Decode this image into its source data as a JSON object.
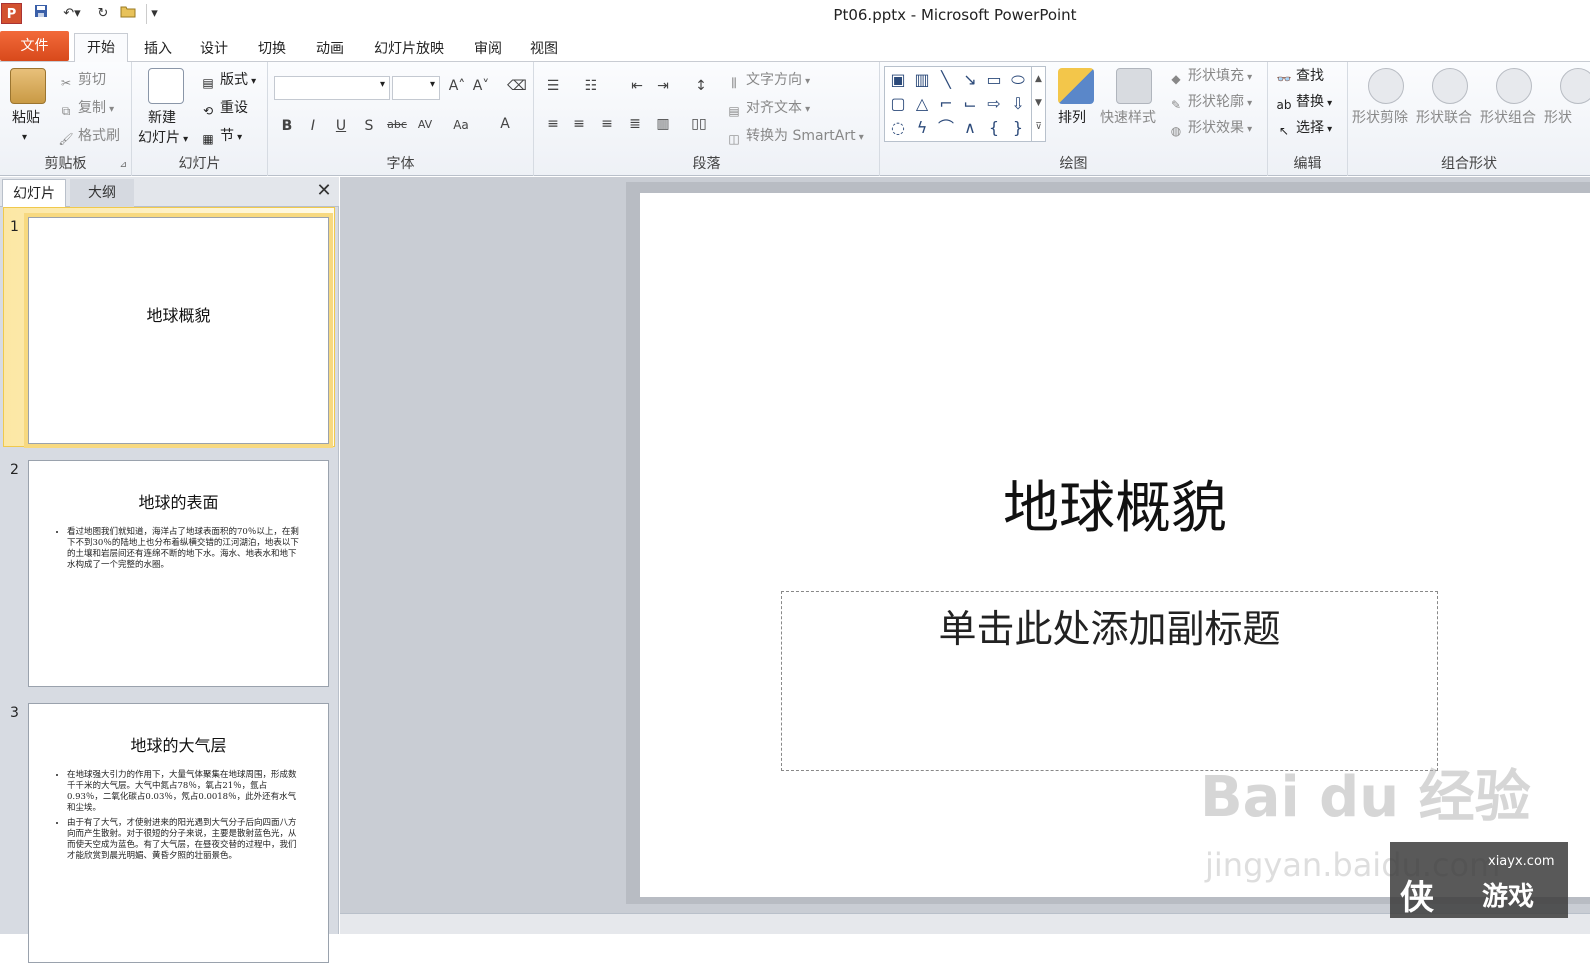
{
  "title": "Pt06.pptx - Microsoft PowerPoint",
  "app_icon": "P",
  "tabs": {
    "file": "文件",
    "home": "开始",
    "insert": "插入",
    "design": "设计",
    "transitions": "切换",
    "animations": "动画",
    "slideshow": "幻灯片放映",
    "review": "审阅",
    "view": "视图"
  },
  "clipboard": {
    "paste": "粘贴",
    "cut": "剪切",
    "copy": "复制",
    "format_painter": "格式刷",
    "label": "剪贴板"
  },
  "slides_group": {
    "new_slide_1": "新建",
    "new_slide_2": "幻灯片",
    "layout": "版式",
    "reset": "重设",
    "section": "节",
    "label": "幻灯片"
  },
  "font_group": {
    "label": "字体"
  },
  "paragraph_group": {
    "text_direction": "文字方向",
    "align_text": "对齐文本",
    "smartart": "转换为 SmartArt",
    "label": "段落"
  },
  "drawing_group": {
    "arrange": "排列",
    "quick_styles": "快速样式",
    "shape_fill": "形状填充",
    "shape_outline": "形状轮廓",
    "shape_effects": "形状效果",
    "label": "绘图"
  },
  "editing_group": {
    "find": "查找",
    "replace": "替换",
    "select": "选择",
    "label": "编辑"
  },
  "combine_group": {
    "subtract": "形状剪除",
    "union": "形状联合",
    "combine": "形状组合",
    "intersect": "形状",
    "label": "组合形状"
  },
  "pane": {
    "slides_tab": "幻灯片",
    "outline_tab": "大纲",
    "close": "✕"
  },
  "thumbnails": [
    {
      "num": "1",
      "title": "地球概貌"
    },
    {
      "num": "2",
      "title": "地球的表面",
      "bullets": [
        "看过地图我们就知道，海洋占了地球表面积的70％以上，在剩下不到30％的陆地上也分布着纵横交错的江河湖泊，地表以下的土壤和岩层间还有连绵不断的地下水。海水、地表水和地下水构成了一个完整的水圈。"
      ]
    },
    {
      "num": "3",
      "title": "地球的大气层",
      "bullets": [
        "在地球强大引力的作用下，大量气体聚集在地球周围，形成数千千米的大气层。大气中氮占78％，氧占21％，氩占0.93％，二氧化碳占0.03％，氖占0.0018％，此外还有水气和尘埃。",
        "由于有了大气，才使射进来的阳光遇到大气分子后向四面八方向而产生散射。对于很短的分子来说，主要是散射蓝色光，从而使天空成为蓝色。有了大气层，在昼夜交替的过程中，我们才能欣赏到晨光明媚、黄昏夕照的壮丽景色。"
      ]
    }
  ],
  "slide": {
    "title": "地球概貌",
    "subtitle_placeholder": "单击此处添加副标题"
  },
  "watermark": {
    "brand": "Bai  du 经验",
    "url": "jingyan.baidu.com",
    "site": "xiayx.com",
    "logo_char": "侠",
    "logo_text": "游戏"
  }
}
